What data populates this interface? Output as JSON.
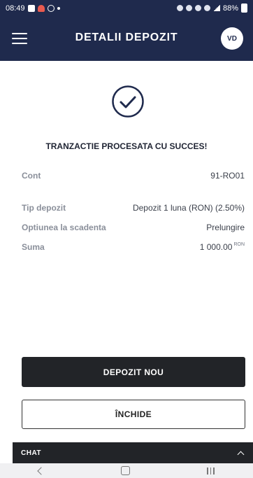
{
  "status_bar": {
    "time": "08:49",
    "battery": "88%"
  },
  "header": {
    "title": "DETALII DEPOZIT",
    "avatar_initials": "VD"
  },
  "success": {
    "title": "TRANZACTIE PROCESATA CU SUCCES!"
  },
  "details": {
    "account": {
      "label": "Cont",
      "value": "91-RO01"
    },
    "deposit_type": {
      "label": "Tip depozit",
      "value": "Depozit 1 luna (RON) (2.50%)"
    },
    "maturity_option": {
      "label": "Optiunea la scadenta",
      "value": "Prelungire"
    },
    "amount": {
      "label": "Suma",
      "value": "1 000.00",
      "currency": "RON"
    }
  },
  "actions": {
    "new_deposit_label": "DEPOZIT NOU",
    "close_label": "ÎNCHIDE"
  },
  "chat": {
    "label": "CHAT"
  },
  "colors": {
    "header_bg": "#1f2a4d",
    "button_dark": "#222428",
    "check_stroke": "#1f2a4d"
  }
}
